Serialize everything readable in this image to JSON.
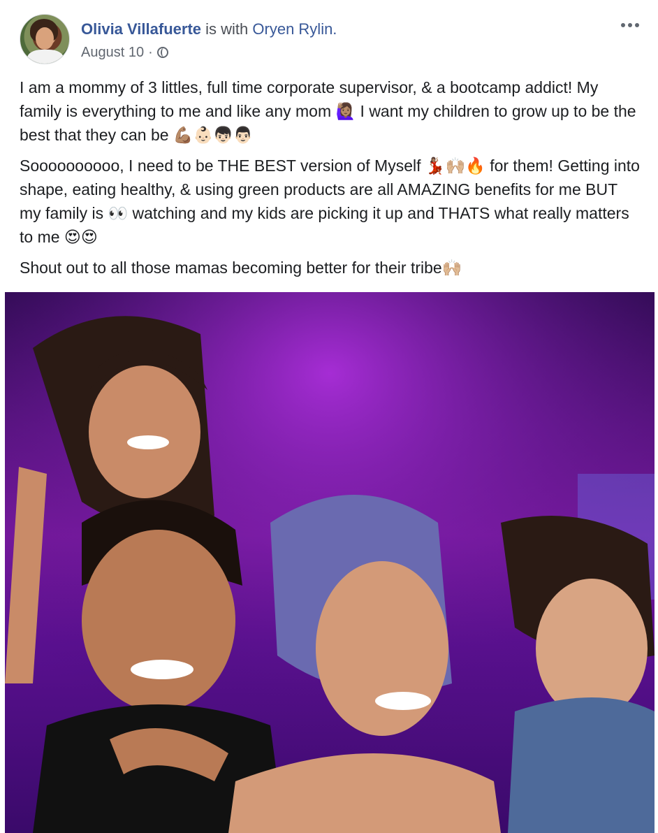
{
  "post": {
    "author": "Olivia Villafuerte",
    "with_text": "is with",
    "with_name": "Oryen Rylin.",
    "date": "August 10",
    "privacy_separator": "·",
    "privacy_icon": "globe-icon",
    "more_icon": "more-dots-icon",
    "paragraphs": [
      "I am a mommy of 3 littles, full time corporate supervisor, & a bootcamp addict! My family is everything to me and like any mom 🙋🏽‍♀️ I want my children to grow up to be the best that they can be 💪🏽👶🏻👦🏻👨🏻",
      "Soooooooooo, I need to be THE BEST version of Myself 💃🏽🙌🏼🔥 for them! Getting into shape, eating healthy, & using green products are all AMAZING benefits for me BUT my family is 👀 watching and my kids are picking it up and THATS what really matters to me 😍😍",
      "Shout out to all those mamas becoming better for their tribe🙌🏼"
    ]
  },
  "colors": {
    "link": "#385898",
    "text": "#1c1e21",
    "meta": "#616770",
    "photo_background": "#7a1aa0"
  }
}
